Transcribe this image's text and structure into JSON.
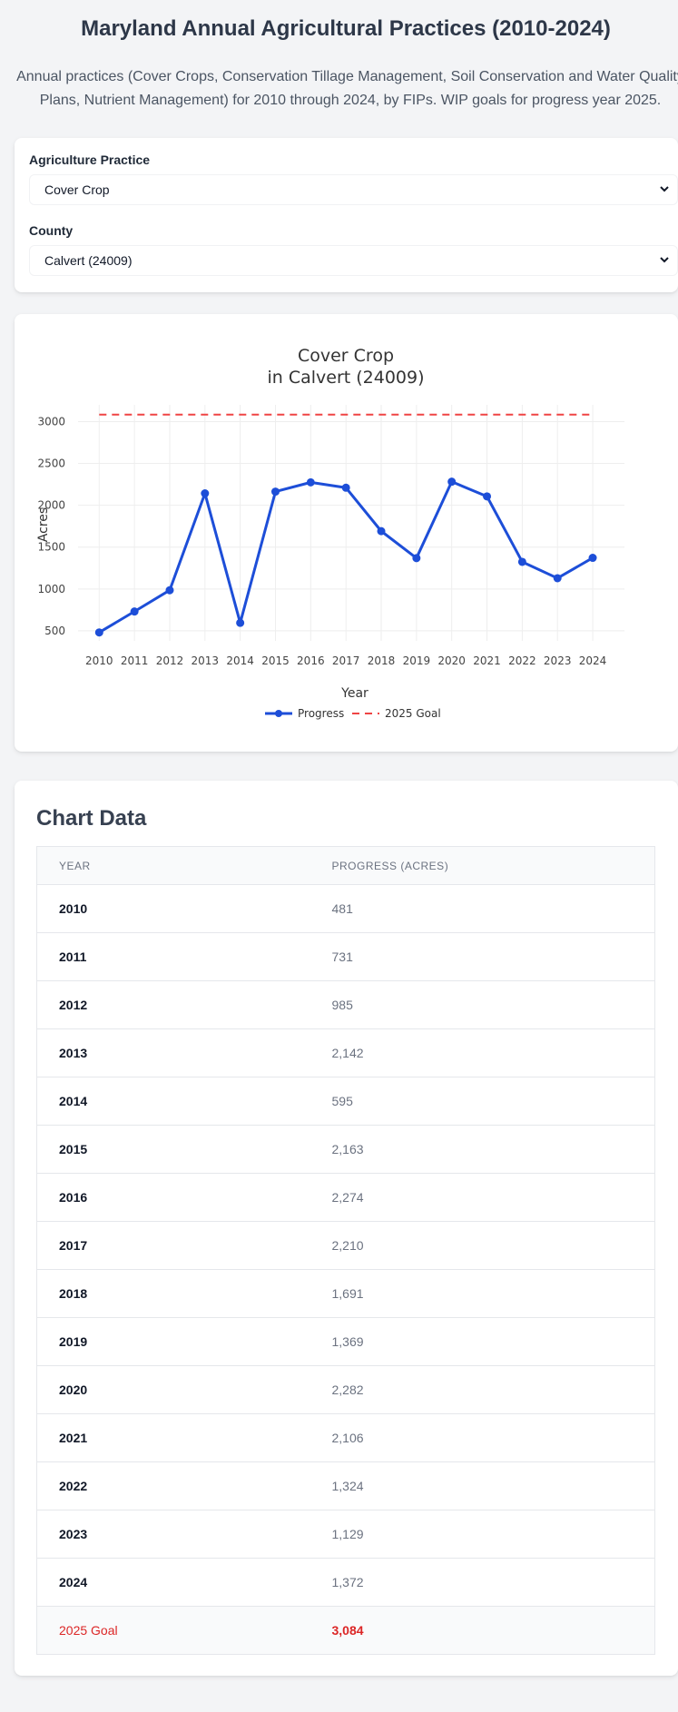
{
  "header": {
    "title": "Maryland Annual Agricultural Practices (2010-2024)",
    "description": "Annual practices (Cover Crops, Conservation Tillage Management, Soil Conservation and Water Quality Plans, Nutrient Management) for 2010 through 2024, by FIPs. WIP goals for progress year 2025."
  },
  "controls": {
    "practice_label": "Agriculture Practice",
    "practice_value": "Cover Crop",
    "county_label": "County",
    "county_value": "Calvert (24009)"
  },
  "chart_data": {
    "type": "line",
    "title": "Cover Crop",
    "subtitle": "in Calvert (24009)",
    "xlabel": "Year",
    "ylabel": "Acres",
    "x": [
      2010,
      2011,
      2012,
      2013,
      2014,
      2015,
      2016,
      2017,
      2018,
      2019,
      2020,
      2021,
      2022,
      2023,
      2024
    ],
    "x_tick_labels": [
      "2010",
      "2011",
      "2012",
      "2013",
      "2014",
      "2015",
      "2016",
      "2017",
      "2018",
      "2019",
      "2020",
      "2021",
      "2022",
      "2023",
      "2024"
    ],
    "y_ticks": [
      500,
      1000,
      1500,
      2000,
      2500,
      3000
    ],
    "y_tick_labels": [
      "500",
      "1000",
      "1500",
      "2000",
      "2500",
      "3000"
    ],
    "ylim": [
      380,
      3200
    ],
    "grid": true,
    "legend_position": "bottom-center",
    "series": [
      {
        "name": "Progress",
        "style": "solid-with-markers",
        "color": "#1d4ed8",
        "values": [
          481,
          731,
          985,
          2142,
          595,
          2163,
          2274,
          2210,
          1691,
          1369,
          2282,
          2106,
          1324,
          1129,
          1372
        ]
      },
      {
        "name": "2025 Goal",
        "style": "dashed",
        "color": "#ef4444",
        "values": [
          3084,
          3084,
          3084,
          3084,
          3084,
          3084,
          3084,
          3084,
          3084,
          3084,
          3084,
          3084,
          3084,
          3084,
          3084
        ]
      }
    ]
  },
  "table": {
    "title": "Chart Data",
    "headers": [
      "Year",
      "Progress (Acres)"
    ],
    "rows": [
      {
        "year": "2010",
        "value": "481"
      },
      {
        "year": "2011",
        "value": "731"
      },
      {
        "year": "2012",
        "value": "985"
      },
      {
        "year": "2013",
        "value": "2,142"
      },
      {
        "year": "2014",
        "value": "595"
      },
      {
        "year": "2015",
        "value": "2,163"
      },
      {
        "year": "2016",
        "value": "2,274"
      },
      {
        "year": "2017",
        "value": "2,210"
      },
      {
        "year": "2018",
        "value": "1,691"
      },
      {
        "year": "2019",
        "value": "1,369"
      },
      {
        "year": "2020",
        "value": "2,282"
      },
      {
        "year": "2021",
        "value": "2,106"
      },
      {
        "year": "2022",
        "value": "1,324"
      },
      {
        "year": "2023",
        "value": "1,129"
      },
      {
        "year": "2024",
        "value": "1,372"
      }
    ],
    "goal_row": {
      "year": "2025 Goal",
      "value": "3,084"
    }
  },
  "colors": {
    "progress": "#1d4ed8",
    "goal": "#ef4444",
    "goal_text": "#dc2626",
    "background": "#f3f4f6"
  }
}
